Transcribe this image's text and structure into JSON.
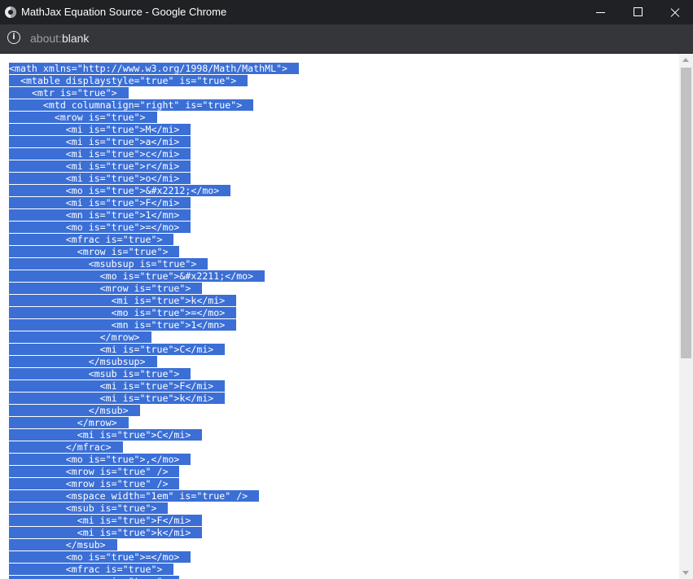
{
  "window": {
    "title": "MathJax Equation Source - Google Chrome",
    "icon": "chrome-icon"
  },
  "addressbar": {
    "scheme": "about:",
    "host": "blank",
    "icon": "info-icon"
  },
  "source": {
    "lines": [
      "<math xmlns=\"http://www.w3.org/1998/Math/MathML\">",
      "  <mtable displaystyle=\"true\" is=\"true\">",
      "    <mtr is=\"true\">",
      "      <mtd columnalign=\"right\" is=\"true\">",
      "        <mrow is=\"true\">",
      "          <mi is=\"true\">M</mi>",
      "          <mi is=\"true\">a</mi>",
      "          <mi is=\"true\">c</mi>",
      "          <mi is=\"true\">r</mi>",
      "          <mi is=\"true\">o</mi>",
      "          <mo is=\"true\">&#x2212;</mo>",
      "          <mi is=\"true\">F</mi>",
      "          <mn is=\"true\">1</mn>",
      "          <mo is=\"true\">=</mo>",
      "          <mfrac is=\"true\">",
      "            <mrow is=\"true\">",
      "              <msubsup is=\"true\">",
      "                <mo is=\"true\">&#x2211;</mo>",
      "                <mrow is=\"true\">",
      "                  <mi is=\"true\">k</mi>",
      "                  <mo is=\"true\">=</mo>",
      "                  <mn is=\"true\">1</mn>",
      "                </mrow>",
      "                <mi is=\"true\">C</mi>",
      "              </msubsup>",
      "              <msub is=\"true\">",
      "                <mi is=\"true\">F</mi>",
      "                <mi is=\"true\">k</mi>",
      "              </msub>",
      "            </mrow>",
      "            <mi is=\"true\">C</mi>",
      "          </mfrac>",
      "          <mo is=\"true\">,</mo>",
      "          <mrow is=\"true\" />",
      "          <mrow is=\"true\" />",
      "          <mspace width=\"1em\" is=\"true\" />",
      "          <msub is=\"true\">",
      "            <mi is=\"true\">F</mi>",
      "            <mi is=\"true\">k</mi>",
      "          </msub>",
      "          <mo is=\"true\">=</mo>",
      "          <mfrac is=\"true\">",
      "            <mrow is=\"true\">"
    ]
  },
  "scrollbar": {
    "position_fraction": 0.0
  },
  "colors": {
    "titlebar": "#202124",
    "addressbar": "#35363a",
    "selection": "#3b6fd6",
    "scroll_thumb": "#c1c1c1"
  }
}
